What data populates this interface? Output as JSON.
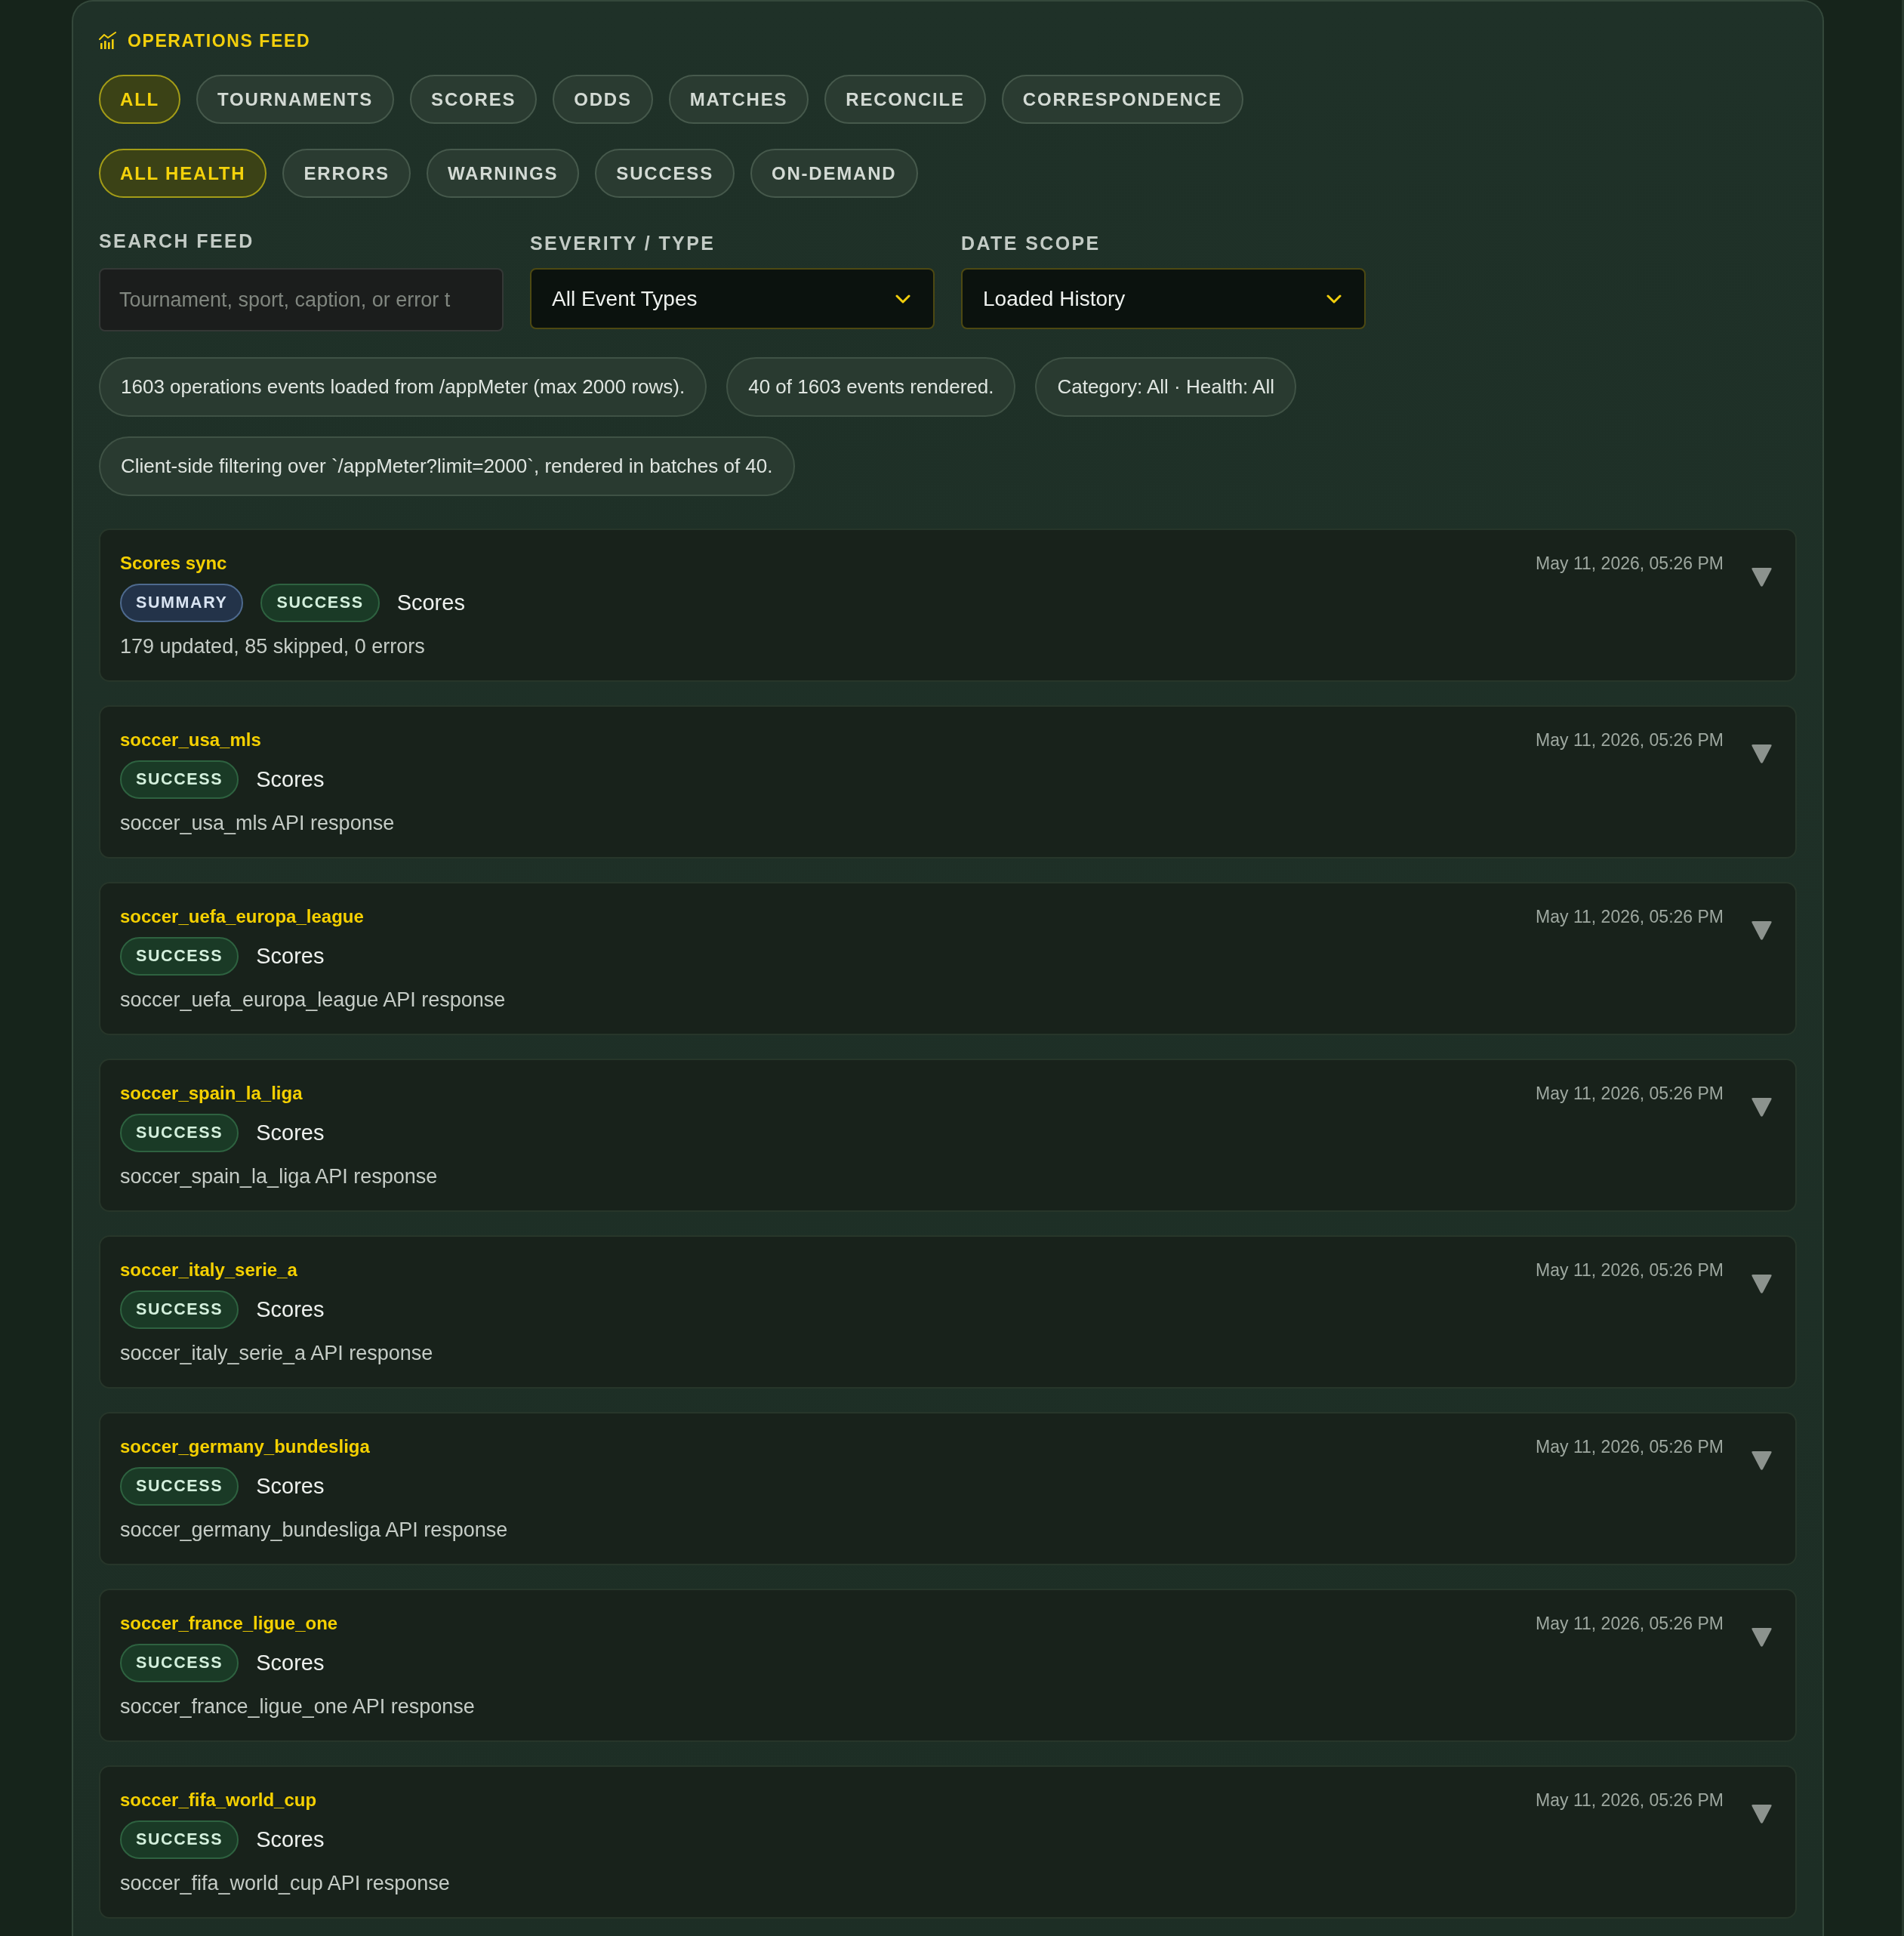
{
  "header": {
    "title": "OPERATIONS FEED"
  },
  "category_filters": [
    {
      "label": "ALL",
      "selected": true
    },
    {
      "label": "TOURNAMENTS",
      "selected": false
    },
    {
      "label": "SCORES",
      "selected": false
    },
    {
      "label": "ODDS",
      "selected": false
    },
    {
      "label": "MATCHES",
      "selected": false
    },
    {
      "label": "RECONCILE",
      "selected": false
    },
    {
      "label": "CORRESPONDENCE",
      "selected": false
    }
  ],
  "health_filters": [
    {
      "label": "ALL HEALTH",
      "selected": true
    },
    {
      "label": "ERRORS",
      "selected": false
    },
    {
      "label": "WARNINGS",
      "selected": false
    },
    {
      "label": "SUCCESS",
      "selected": false
    },
    {
      "label": "ON-DEMAND",
      "selected": false
    }
  ],
  "search": {
    "label": "SEARCH FEED",
    "placeholder": "Tournament, sport, caption, or error t"
  },
  "severity": {
    "label": "SEVERITY / TYPE",
    "value": "All Event Types"
  },
  "date_scope": {
    "label": "DATE SCOPE",
    "value": "Loaded History"
  },
  "summary_pills": [
    "1603 operations events loaded from /appMeter (max 2000 rows).",
    "40 of 1603 events rendered.",
    "Category: All · Health: All",
    "Client-side filtering over `/appMeter?limit=2000`, rendered in batches of 40."
  ],
  "events": [
    {
      "title": "Scores sync",
      "badges": [
        {
          "label": "SUMMARY",
          "kind": "summary"
        },
        {
          "label": "SUCCESS",
          "kind": "success"
        }
      ],
      "category": "Scores",
      "message": "179 updated, 85 skipped, 0 errors",
      "time": "May 11, 2026, 05:26 PM"
    },
    {
      "title": "soccer_usa_mls",
      "badges": [
        {
          "label": "SUCCESS",
          "kind": "success"
        }
      ],
      "category": "Scores",
      "message": "soccer_usa_mls API response",
      "time": "May 11, 2026, 05:26 PM"
    },
    {
      "title": "soccer_uefa_europa_league",
      "badges": [
        {
          "label": "SUCCESS",
          "kind": "success"
        }
      ],
      "category": "Scores",
      "message": "soccer_uefa_europa_league API response",
      "time": "May 11, 2026, 05:26 PM"
    },
    {
      "title": "soccer_spain_la_liga",
      "badges": [
        {
          "label": "SUCCESS",
          "kind": "success"
        }
      ],
      "category": "Scores",
      "message": "soccer_spain_la_liga API response",
      "time": "May 11, 2026, 05:26 PM"
    },
    {
      "title": "soccer_italy_serie_a",
      "badges": [
        {
          "label": "SUCCESS",
          "kind": "success"
        }
      ],
      "category": "Scores",
      "message": "soccer_italy_serie_a API response",
      "time": "May 11, 2026, 05:26 PM"
    },
    {
      "title": "soccer_germany_bundesliga",
      "badges": [
        {
          "label": "SUCCESS",
          "kind": "success"
        }
      ],
      "category": "Scores",
      "message": "soccer_germany_bundesliga API response",
      "time": "May 11, 2026, 05:26 PM"
    },
    {
      "title": "soccer_france_ligue_one",
      "badges": [
        {
          "label": "SUCCESS",
          "kind": "success"
        }
      ],
      "category": "Scores",
      "message": "soccer_france_ligue_one API response",
      "time": "May 11, 2026, 05:26 PM"
    },
    {
      "title": "soccer_fifa_world_cup",
      "badges": [
        {
          "label": "SUCCESS",
          "kind": "success"
        }
      ],
      "category": "Scores",
      "message": "soccer_fifa_world_cup API response",
      "time": "May 11, 2026, 05:26 PM"
    }
  ]
}
